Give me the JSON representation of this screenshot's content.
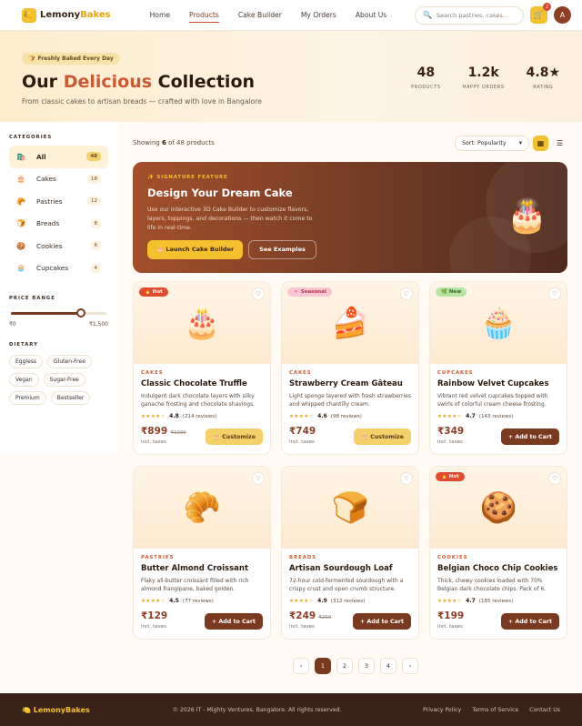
{
  "nav": {
    "brand_a": "Lemony",
    "brand_b": "Bakes",
    "links": [
      "Home",
      "Products",
      "Cake Builder",
      "My Orders",
      "About Us"
    ],
    "active": "Products",
    "search_placeholder": "Search pastries, cakes...",
    "cart_count": "2",
    "avatar_initial": "A"
  },
  "hero": {
    "badge": "Freshly Baked Every Day",
    "title_a": "Our",
    "title_b": "Delicious",
    "title_c": "Collection",
    "subtitle": "From classic cakes to artisan breads — crafted with love in Bangalore",
    "stats": [
      {
        "value": "48",
        "label": "PRODUCTS"
      },
      {
        "value": "1.2k",
        "label": "HAPPY ORDERS"
      },
      {
        "value": "4.8★",
        "label": "RATING"
      }
    ]
  },
  "sidebar": {
    "categories_heading": "CATEGORIES",
    "categories": [
      {
        "icon": "🛍️",
        "label": "All",
        "count": "48"
      },
      {
        "icon": "🎂",
        "label": "Cakes",
        "count": "18"
      },
      {
        "icon": "🥐",
        "label": "Pastries",
        "count": "12"
      },
      {
        "icon": "🍞",
        "label": "Breads",
        "count": "8"
      },
      {
        "icon": "🍪",
        "label": "Cookies",
        "count": "6"
      },
      {
        "icon": "🧁",
        "label": "Cupcakes",
        "count": "4"
      }
    ],
    "price_heading": "PRICE RANGE",
    "price_min": "₹0",
    "price_max": "₹1,500",
    "price_level": 0.7,
    "dietary_heading": "DIETARY",
    "dietary": [
      "Eggless",
      "Gluten-Free",
      "Vegan",
      "Sugar-Free",
      "Premium",
      "Bestseller"
    ]
  },
  "toolbar": {
    "showing_a": "Showing",
    "showing_n": "6",
    "showing_b": "of 48 products",
    "sort": "Sort: Popularity"
  },
  "banner": {
    "eyebrow": "✨ SIGNATURE FEATURE",
    "title": "Design Your Dream Cake",
    "text": "Use our interactive 3D Cake Builder to customize flavors, layers, toppings, and decorations — then watch it come to life in real-time.",
    "primary": "🎂 Launch Cake Builder",
    "secondary": "See Examples",
    "art": "🎂"
  },
  "products": [
    {
      "badge": "🔥 Hot",
      "badge_type": "hot",
      "emoji": "🎂",
      "category": "CAKES",
      "name": "Classic Chocolate Truffle",
      "desc": "Indulgent dark chocolate layers with silky ganache frosting and chocolate shavings.",
      "stars": "★★★★☆",
      "rating": "4.8",
      "reviews": "(214 reviews)",
      "price": "₹899",
      "old_price": "₹1099",
      "tax": "incl. taxes",
      "button": "🎂 Customize",
      "button_type": "cust"
    },
    {
      "badge": "🌸 Seasonal",
      "badge_type": "seasonal",
      "emoji": "🍰",
      "category": "CAKES",
      "name": "Strawberry Cream Gâteau",
      "desc": "Light sponge layered with fresh strawberries and whipped chantilly cream.",
      "stars": "★★★★☆",
      "rating": "4.6",
      "reviews": "(98 reviews)",
      "price": "₹749",
      "old_price": "",
      "tax": "incl. taxes",
      "button": "🎂 Customize",
      "button_type": "cust"
    },
    {
      "badge": "🌿 New",
      "badge_type": "new",
      "emoji": "🧁",
      "category": "CUPCAKES",
      "name": "Rainbow Velvet Cupcakes",
      "desc": "Vibrant red velvet cupcakes topped with swirls of colorful cream cheese frosting.",
      "stars": "★★★★☆",
      "rating": "4.7",
      "reviews": "(143 reviews)",
      "price": "₹349",
      "old_price": "",
      "tax": "incl. taxes",
      "button": "+ Add to Cart",
      "button_type": "add"
    },
    {
      "badge": "",
      "badge_type": "",
      "emoji": "🥐",
      "category": "PASTRIES",
      "name": "Butter Almond Croissant",
      "desc": "Flaky all-butter croissant filled with rich almond frangipane, baked golden.",
      "stars": "★★★★☆",
      "rating": "4.5",
      "reviews": "(77 reviews)",
      "price": "₹129",
      "old_price": "",
      "tax": "incl. taxes",
      "button": "+ Add to Cart",
      "button_type": "add"
    },
    {
      "badge": "",
      "badge_type": "",
      "emoji": "🍞",
      "category": "BREADS",
      "name": "Artisan Sourdough Loaf",
      "desc": "72-hour cold-fermented sourdough with a crispy crust and open crumb structure.",
      "stars": "★★★★☆",
      "rating": "4.9",
      "reviews": "(312 reviews)",
      "price": "₹249",
      "old_price": "₹299",
      "tax": "incl. taxes",
      "button": "+ Add to Cart",
      "button_type": "add"
    },
    {
      "badge": "🔥 Hot",
      "badge_type": "hot",
      "emoji": "🍪",
      "category": "COOKIES",
      "name": "Belgian Choco Chip Cookies",
      "desc": "Thick, chewy cookies loaded with 70% Belgian dark chocolate chips. Pack of 6.",
      "stars": "★★★★☆",
      "rating": "4.7",
      "reviews": "(185 reviews)",
      "price": "₹199",
      "old_price": "",
      "tax": "incl. taxes",
      "button": "+ Add to Cart",
      "button_type": "add"
    }
  ],
  "pagination": [
    "‹",
    "1",
    "2",
    "3",
    "4",
    "›"
  ],
  "pagination_active": "1",
  "footer": {
    "brand": "🍋 LemonyBakes",
    "copyright": "© 2026 IT - Mighty Ventures, Bangalore. All rights reserved.",
    "links": [
      "Privacy Policy",
      "Terms of Service",
      "Contact Us"
    ]
  },
  "colors": {
    "accent": "#f3c12d",
    "brand_brown": "#7a3a20",
    "hot": "#e04a2f"
  }
}
